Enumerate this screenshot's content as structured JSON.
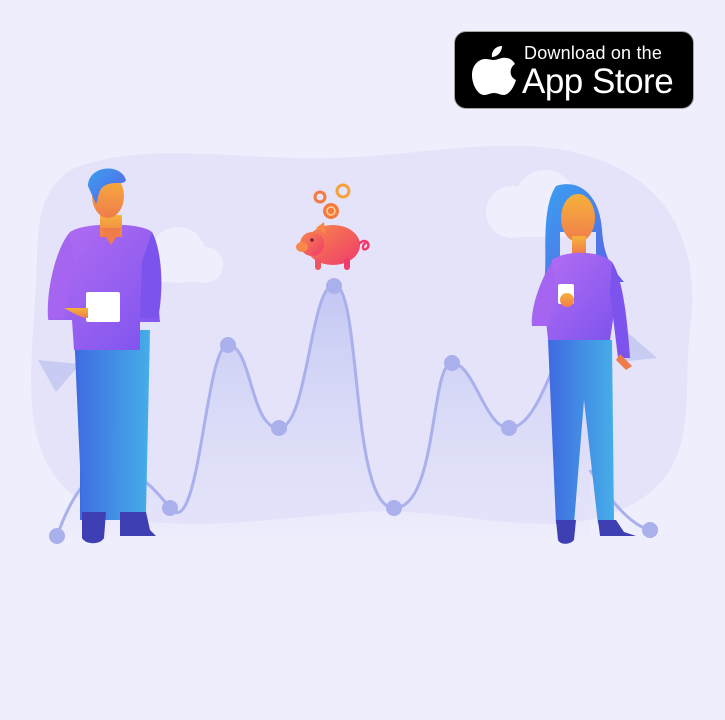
{
  "badge": {
    "line1": "Download on the",
    "line2": "App Store",
    "icon": "apple-logo-icon"
  },
  "colors": {
    "background": "#efeefc",
    "blob": "#e4e3fa",
    "wave": "#a9b0ec",
    "purple": "#9b5cf0",
    "blue": "#4d7ee8",
    "pig": "#f2456a",
    "coin": "#f7a13c"
  }
}
